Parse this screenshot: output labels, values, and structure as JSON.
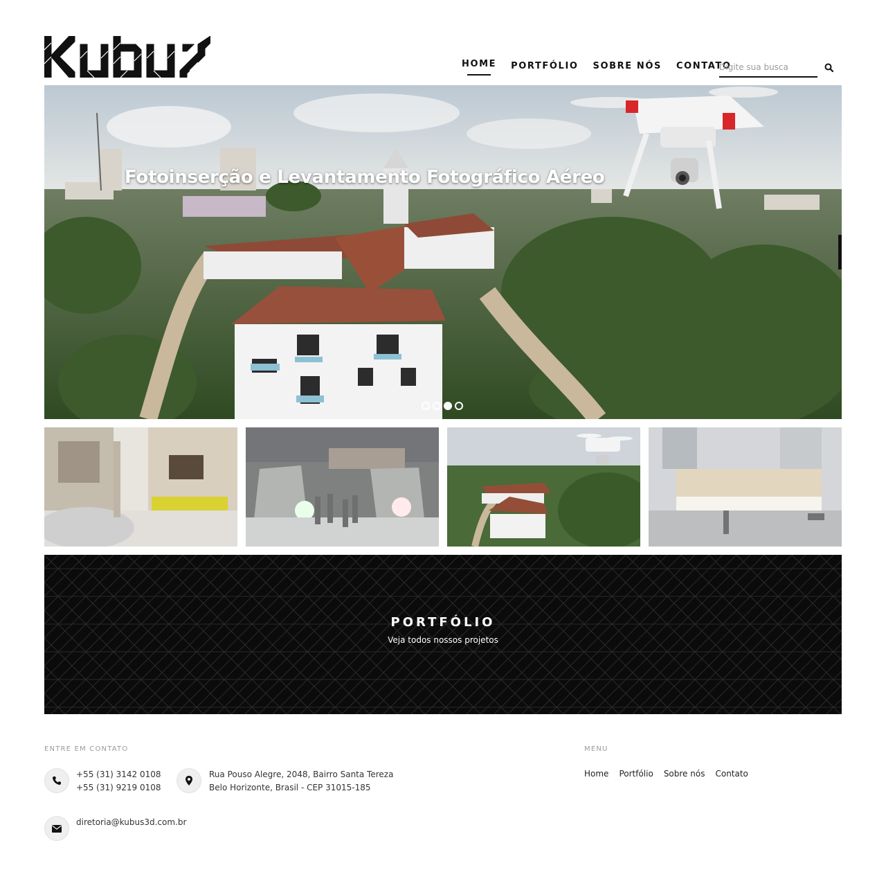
{
  "brand": {
    "logo_text": "kubus"
  },
  "nav": {
    "items": [
      {
        "label": "HOME",
        "active": true
      },
      {
        "label": "PORTFÓLIO",
        "active": false
      },
      {
        "label": "SOBRE NÓS",
        "active": false
      },
      {
        "label": "CONTATO",
        "active": false
      }
    ]
  },
  "search": {
    "placeholder": "Digite sua busca",
    "value": "",
    "icon": "search-icon"
  },
  "hero": {
    "title": "Fotoinserção e Levantamento Fotográfico Aéreo",
    "slides_total": 4,
    "active_slide": 3
  },
  "thumbnails": [
    {
      "subject": "interior-bedroom-render"
    },
    {
      "subject": "night-plaza-render"
    },
    {
      "subject": "aerial-drone-photo"
    },
    {
      "subject": "building-facade-photomontage"
    }
  ],
  "portfolio_banner": {
    "title": "PORTFÓLIO",
    "subtitle": "Veja todos nossos projetos"
  },
  "footer": {
    "contact_heading": "ENTRE EM CONTATO",
    "phone_icon": "phone-icon",
    "phones": [
      "+55 (31) 3142 0108",
      "+55 (31) 9219 0108"
    ],
    "location_icon": "map-pin-icon",
    "address": [
      "Rua Pouso Alegre, 2048, Bairro Santa Tereza",
      "Belo Horizonte, Brasil - CEP 31015-185"
    ],
    "email_icon": "envelope-icon",
    "email": "diretoria@kubus3d.com.br",
    "menu_heading": "MENU",
    "menu": [
      "Home",
      "Portfólio",
      "Sobre nós",
      "Contato"
    ]
  }
}
